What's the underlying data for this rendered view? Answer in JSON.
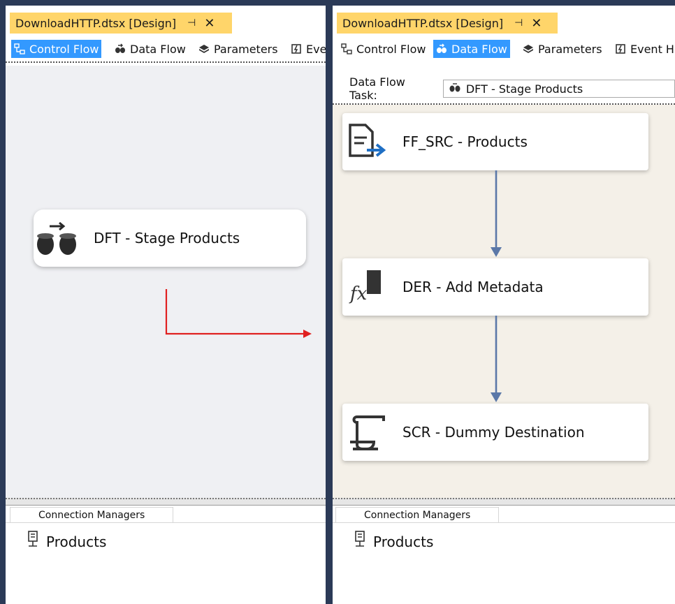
{
  "left_pane": {
    "doc_tab": {
      "title": "DownloadHTTP.dtsx [Design]",
      "pin": "⊣",
      "close": "✕"
    },
    "toolbar": [
      {
        "label": "Control Flow",
        "icon": "control-flow-icon",
        "active": true
      },
      {
        "label": "Data Flow",
        "icon": "data-flow-icon",
        "active": false
      },
      {
        "label": "Parameters",
        "icon": "parameters-icon",
        "active": false
      },
      {
        "label": "Eve",
        "icon": "event-handlers-icon",
        "active": false
      }
    ],
    "task": {
      "label": "DFT - Stage Products",
      "icon": "data-flow-task-icon"
    },
    "connection_managers": {
      "tab": "Connection Managers",
      "items": [
        {
          "label": "Products",
          "icon": "flat-file-connection-icon"
        }
      ]
    }
  },
  "right_pane": {
    "doc_tab": {
      "title": "DownloadHTTP.dtsx [Design]",
      "pin": "⊣",
      "close": "✕"
    },
    "toolbar": [
      {
        "label": "Control Flow",
        "icon": "control-flow-icon",
        "active": false
      },
      {
        "label": "Data Flow",
        "icon": "data-flow-icon",
        "active": true
      },
      {
        "label": "Parameters",
        "icon": "parameters-icon",
        "active": false
      },
      {
        "label": "Event H",
        "icon": "event-handlers-icon",
        "active": false
      }
    ],
    "data_flow_task": {
      "label": "Data Flow Task:",
      "value": "DFT - Stage Products"
    },
    "components": [
      {
        "label": "FF_SRC - Products",
        "icon": "flat-file-source-icon"
      },
      {
        "label": "DER - Add Metadata",
        "icon": "derived-column-icon"
      },
      {
        "label": "SCR - Dummy Destination",
        "icon": "script-component-icon"
      }
    ],
    "connection_managers": {
      "tab": "Connection Managers",
      "items": [
        {
          "label": "Products",
          "icon": "flat-file-connection-icon"
        }
      ]
    }
  },
  "colors": {
    "accent": "#3399ff",
    "tab_highlight": "#ffd56a",
    "arrow": "#e02020",
    "path": "#5b78a8"
  }
}
